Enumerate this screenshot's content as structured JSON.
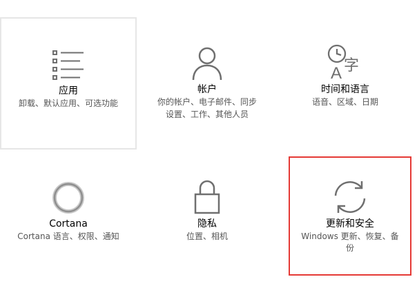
{
  "tiles": [
    {
      "title": "应用",
      "desc": [
        "卸载、默认应用、可选功能"
      ]
    },
    {
      "title": "帐户",
      "desc": [
        "你的帐户、电子邮件、同步",
        "设置、工作、其他人员"
      ]
    },
    {
      "title": "时间和语言",
      "desc": [
        "语音、区域、日期"
      ]
    },
    {
      "title": "Cortana",
      "desc": [
        "Cortana 语言、权限、通知"
      ]
    },
    {
      "title": "隐私",
      "desc": [
        "位置、相机"
      ]
    },
    {
      "title": "更新和安全",
      "desc": [
        "Windows 更新、恢复、备",
        "份"
      ]
    }
  ],
  "icons": {
    "apps": "apps-list-icon",
    "accounts": "person-icon",
    "time": "clock-language-icon",
    "cortana": "cortana-ring-icon",
    "privacy": "lock-icon",
    "update": "sync-arrows-icon"
  },
  "time_icon_glyphs": {
    "letter": "A",
    "char": "字"
  },
  "colors": {
    "icon": "#6f6f6f",
    "selected_border": "#e53935",
    "hover_border": "#e6e6e6"
  }
}
